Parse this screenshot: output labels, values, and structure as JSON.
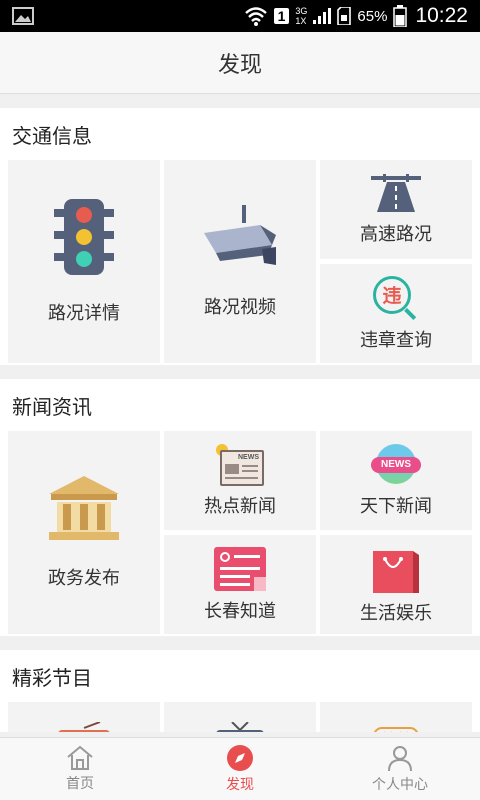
{
  "status_bar": {
    "sim": "1",
    "net_top": "3G",
    "net_bottom": "1X",
    "battery_pct": "65%",
    "time": "10:22"
  },
  "header": {
    "title": "发现"
  },
  "sections": {
    "traffic": {
      "title": "交通信息",
      "items": [
        {
          "label": "路况详情",
          "icon": "traffic-light-icon"
        },
        {
          "label": "路况视频",
          "icon": "camera-icon"
        },
        {
          "label": "高速路况",
          "icon": "highway-icon"
        },
        {
          "label": "违章查询",
          "icon": "violation-search-icon",
          "glyph": "违"
        }
      ]
    },
    "news": {
      "title": "新闻资讯",
      "items": [
        {
          "label": "政务发布",
          "icon": "government-building-icon"
        },
        {
          "label": "热点新闻",
          "icon": "hot-news-icon",
          "glyph": "NEWS"
        },
        {
          "label": "天下新闻",
          "icon": "world-news-icon",
          "glyph": "NEWS"
        },
        {
          "label": "长春知道",
          "icon": "changchun-know-icon"
        },
        {
          "label": "生活娱乐",
          "icon": "shopping-bag-icon"
        }
      ]
    },
    "programs": {
      "title": "精彩节目",
      "items": [
        {
          "icon": "radio-icon"
        },
        {
          "icon": "tv-icon"
        },
        {
          "icon": "cat-icon"
        }
      ]
    }
  },
  "tabbar": {
    "tabs": [
      {
        "label": "首页",
        "icon": "home-icon"
      },
      {
        "label": "发现",
        "icon": "compass-icon",
        "active": true
      },
      {
        "label": "个人中心",
        "icon": "user-icon"
      }
    ]
  },
  "colors": {
    "accent": "#e94e4e",
    "tile_bg": "#f3f3f3",
    "page_bg": "#f0f0f0"
  }
}
